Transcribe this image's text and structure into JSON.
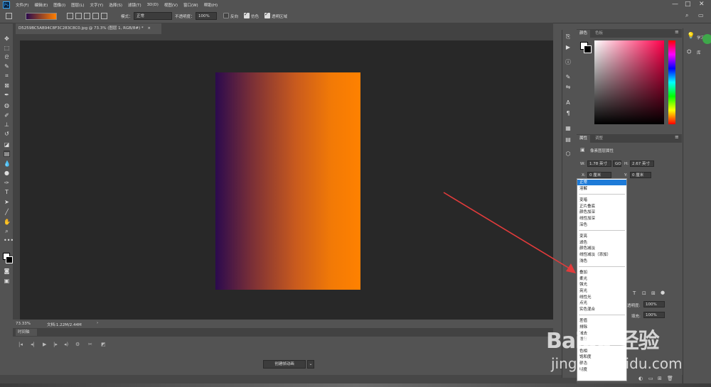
{
  "menubar": {
    "app_icon": "Ps",
    "items": [
      "文件(F)",
      "编辑(E)",
      "图像(I)",
      "图层(L)",
      "文字(Y)",
      "选择(S)",
      "滤镜(T)",
      "3D(D)",
      "视图(V)",
      "窗口(W)",
      "帮助(H)"
    ],
    "window_controls": [
      "—",
      "□",
      "✕"
    ]
  },
  "options": {
    "mode_label": "模式：",
    "mode_value": "正常",
    "opacity_label": "不透明度：",
    "opacity_value": "100%",
    "reverse_label": "反向",
    "dither_label": "仿色",
    "transparency_label": "透明区域"
  },
  "document": {
    "tab_title": "D5259BC5AB94C8F3C283C8C0.jpg @ 73.3% (图层 1, RGB/8#) *",
    "tab_close": "×",
    "zoom": "73.33%",
    "doc_info": "文档:1.22M/2.44M",
    "gradient_colors": [
      "#2b0a4e",
      "#ff8100"
    ]
  },
  "timeline": {
    "title": "时间轴",
    "create_button": "创建帧动画"
  },
  "color_panel": {
    "tabs": [
      "颜色",
      "色板"
    ],
    "fg_color": "#ffffff",
    "bg_color": "#000000"
  },
  "properties_panel": {
    "tabs": [
      "属性",
      "调整"
    ],
    "header": "像素图层属性",
    "w_label": "W:",
    "w_value": "1.78 英寸",
    "link": "GO",
    "h_label": "H:",
    "h_value": "2.67 英寸",
    "x_label": "X:",
    "x_value": "0 厘米",
    "y_label": "Y:",
    "y_value": "0 厘米"
  },
  "blend_dropdown": {
    "groups": [
      [
        "正常",
        "溶解"
      ],
      [
        "变暗",
        "正片叠底",
        "颜色加深",
        "线性加深",
        "深色"
      ],
      [
        "变亮",
        "滤色",
        "颜色减淡",
        "线性减淡（添加）",
        "浅色"
      ],
      [
        "叠加",
        "柔光",
        "强光",
        "亮光",
        "线性光",
        "点光",
        "实色混合"
      ],
      [
        "差值",
        "排除",
        "减去",
        "划分"
      ],
      [
        "色相",
        "饱和度",
        "颜色",
        "明度"
      ]
    ],
    "selected": "正常"
  },
  "layers_panel": {
    "opacity_label": "透明度:",
    "opacity_value": "100%",
    "fill_label": "填充:",
    "fill_value": "100%"
  },
  "far_right": {
    "learn_label": "学习",
    "library_label": "库"
  },
  "watermark": {
    "line1": "Baidu 经验",
    "line2": "jingyan.baidu.com"
  },
  "annotation": {
    "arrow_color": "#e23b3b"
  }
}
